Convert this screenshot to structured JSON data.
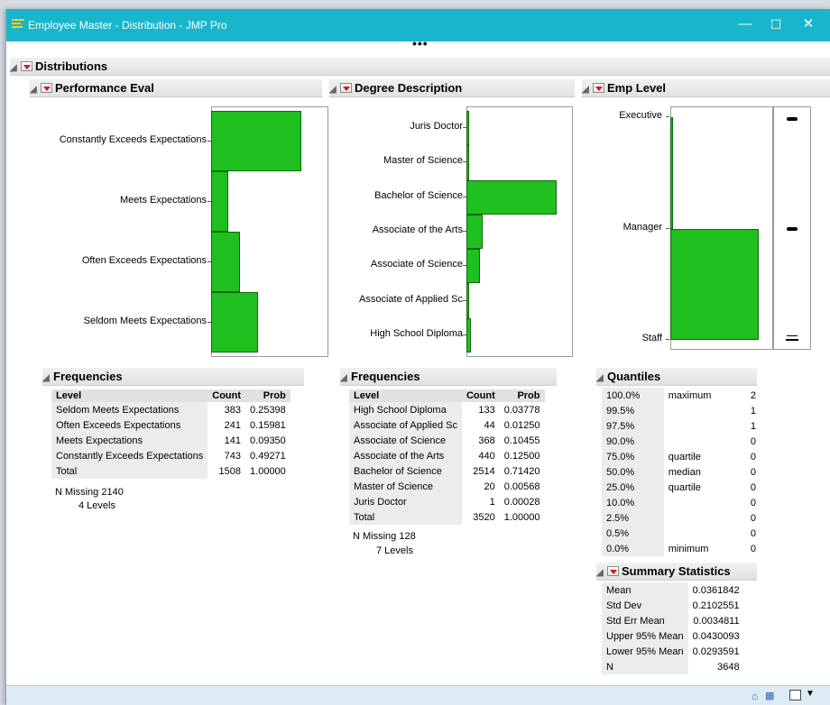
{
  "window": {
    "title": "Employee Master - Distribution - JMP Pro",
    "minimize": "—",
    "maximize": "☐",
    "close": "✕"
  },
  "toolbar": {
    "ellipsis": "•••"
  },
  "report": {
    "title": "Distributions",
    "performance": {
      "title": "Performance Eval",
      "levels": [
        "Constantly Exceeds Expectations",
        "Meets Expectations",
        "Often Exceeds Expectations",
        "Seldom Meets Expectations"
      ],
      "bar_values": [
        743,
        141,
        241,
        383
      ],
      "freq": {
        "title": "Frequencies",
        "headers": [
          "Level",
          "Count",
          "Prob"
        ],
        "rows": [
          [
            "Seldom Meets Expectations",
            "383",
            "0.25398"
          ],
          [
            "Often Exceeds Expectations",
            "241",
            "0.15981"
          ],
          [
            "Meets Expectations",
            "141",
            "0.09350"
          ],
          [
            "Constantly Exceeds Expectations",
            "743",
            "0.49271"
          ],
          [
            "Total",
            "1508",
            "1.00000"
          ]
        ],
        "missing": "N Missing   2140",
        "levels": "4  Levels"
      }
    },
    "degree": {
      "title": "Degree Description",
      "levels": [
        "Juris Doctor",
        "Master of Science",
        "Bachelor of Science",
        "Associate of the Arts",
        "Associate of Science",
        "Associate of Applied Sc",
        "High School Diploma"
      ],
      "bar_values": [
        1,
        20,
        2514,
        440,
        368,
        44,
        133
      ],
      "freq": {
        "title": "Frequencies",
        "headers": [
          "Level",
          "Count",
          "Prob"
        ],
        "rows": [
          [
            "High School Diploma",
            "133",
            "0.03778"
          ],
          [
            "Associate of Applied Sc",
            "44",
            "0.01250"
          ],
          [
            "Associate of Science",
            "368",
            "0.10455"
          ],
          [
            "Associate of the Arts",
            "440",
            "0.12500"
          ],
          [
            "Bachelor of Science",
            "2514",
            "0.71420"
          ],
          [
            "Master of Science",
            "20",
            "0.00568"
          ],
          [
            "Juris Doctor",
            "1",
            "0.00028"
          ],
          [
            "Total",
            "3520",
            "1.00000"
          ]
        ],
        "missing": "N Missing    128",
        "levels": "7  Levels"
      }
    },
    "emp": {
      "title": "Emp Level",
      "levels": [
        "Executive",
        "Manager",
        "Staff"
      ],
      "bar_values": [
        0,
        0,
        3648
      ],
      "quantiles": {
        "title": "Quantiles",
        "rows": [
          [
            "100.0%",
            "maximum",
            "2"
          ],
          [
            "99.5%",
            "",
            "1"
          ],
          [
            "97.5%",
            "",
            "1"
          ],
          [
            "90.0%",
            "",
            "0"
          ],
          [
            "75.0%",
            "quartile",
            "0"
          ],
          [
            "50.0%",
            "median",
            "0"
          ],
          [
            "25.0%",
            "quartile",
            "0"
          ],
          [
            "10.0%",
            "",
            "0"
          ],
          [
            "2.5%",
            "",
            "0"
          ],
          [
            "0.5%",
            "",
            "0"
          ],
          [
            "0.0%",
            "minimum",
            "0"
          ]
        ]
      },
      "summary": {
        "title": "Summary Statistics",
        "rows": [
          [
            "Mean",
            "0.0361842"
          ],
          [
            "Std Dev",
            "0.2102551"
          ],
          [
            "Std Err Mean",
            "0.0034811"
          ],
          [
            "Upper 95% Mean",
            "0.0430093"
          ],
          [
            "Lower 95% Mean",
            "0.0293591"
          ],
          [
            "N",
            "3648"
          ]
        ]
      }
    }
  },
  "status": {
    "home_icon": "home-icon",
    "table_icon": "table-icon",
    "checkbox_icon": "checkbox-icon",
    "dropdown_icon": "dropdown-icon"
  },
  "colors": {
    "titlebar": "#19b5cc",
    "bar_fill": "#1fbf1f",
    "statusbar": "#dcebf6"
  }
}
